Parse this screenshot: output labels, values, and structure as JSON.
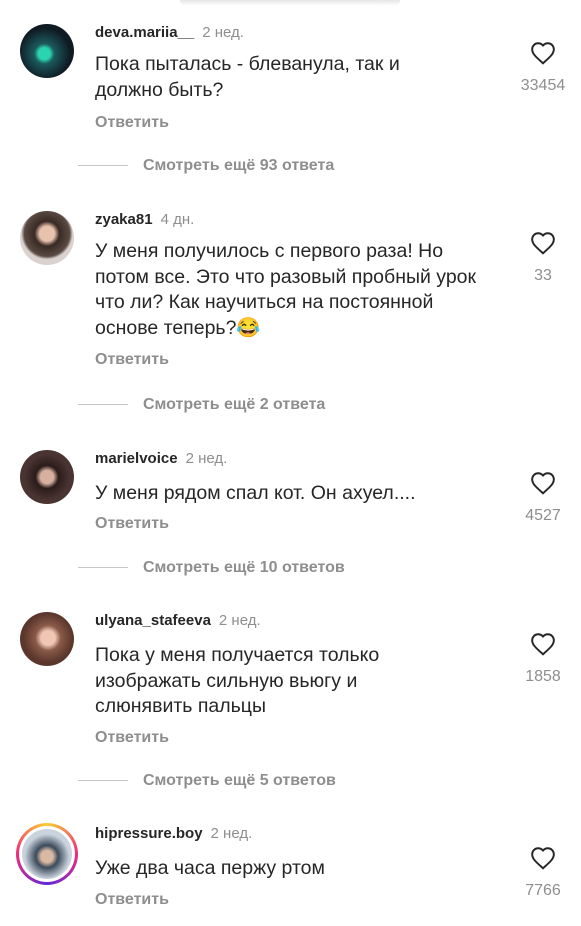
{
  "comments": [
    {
      "username": "deva.mariia__",
      "time": "2 нед.",
      "text": "Пока пыталась - блеванула, так и должно быть?",
      "reply_label": "Ответить",
      "likes": "33454",
      "more_replies": "Смотреть ещё 93 ответа",
      "avatar_colors": [
        "#0f1a22",
        "#2bd4b0"
      ]
    },
    {
      "username": "zyaka81",
      "time": "4 дн.",
      "text": "У меня получилось с первого раза! Но потом все. Это что разовый пробный урок что ли? Как научиться на постоянной основе теперь?😂",
      "reply_label": "Ответить",
      "likes": "33",
      "more_replies": "Смотреть ещё 2 ответа",
      "avatar_colors": [
        "#cfc6c2",
        "#3a2a24"
      ]
    },
    {
      "username": "marielvoice",
      "time": "2 нед.",
      "text": "У меня рядом спал кот. Он ахуел....",
      "reply_label": "Ответить",
      "likes": "4527",
      "more_replies": "Смотреть ещё 10 ответов",
      "avatar_colors": [
        "#2a1c1a",
        "#c89a86"
      ]
    },
    {
      "username": "ulyana_stafeeva",
      "time": "2 нед.",
      "text": "Пока у меня получается только изображать сильную вьюгу и слюнявить пальцы",
      "reply_label": "Ответить",
      "likes": "1858",
      "more_replies": "Смотреть ещё 5 ответов",
      "avatar_colors": [
        "#8a5a48",
        "#e5b9a6"
      ]
    },
    {
      "username": "hipressure.boy",
      "time": "2 нед.",
      "text": "Уже два часа пержу ртом",
      "reply_label": "Ответить",
      "likes": "7766",
      "avatar_colors": [
        "#3b4a5a",
        "#c9b7a8"
      ]
    }
  ],
  "colors": {
    "text": "#262626",
    "secondary": "#8e8e8e",
    "divider": "#c7c7c7",
    "story_ring": [
      "#f9ce34",
      "#ee2a7b",
      "#6228d7"
    ]
  }
}
